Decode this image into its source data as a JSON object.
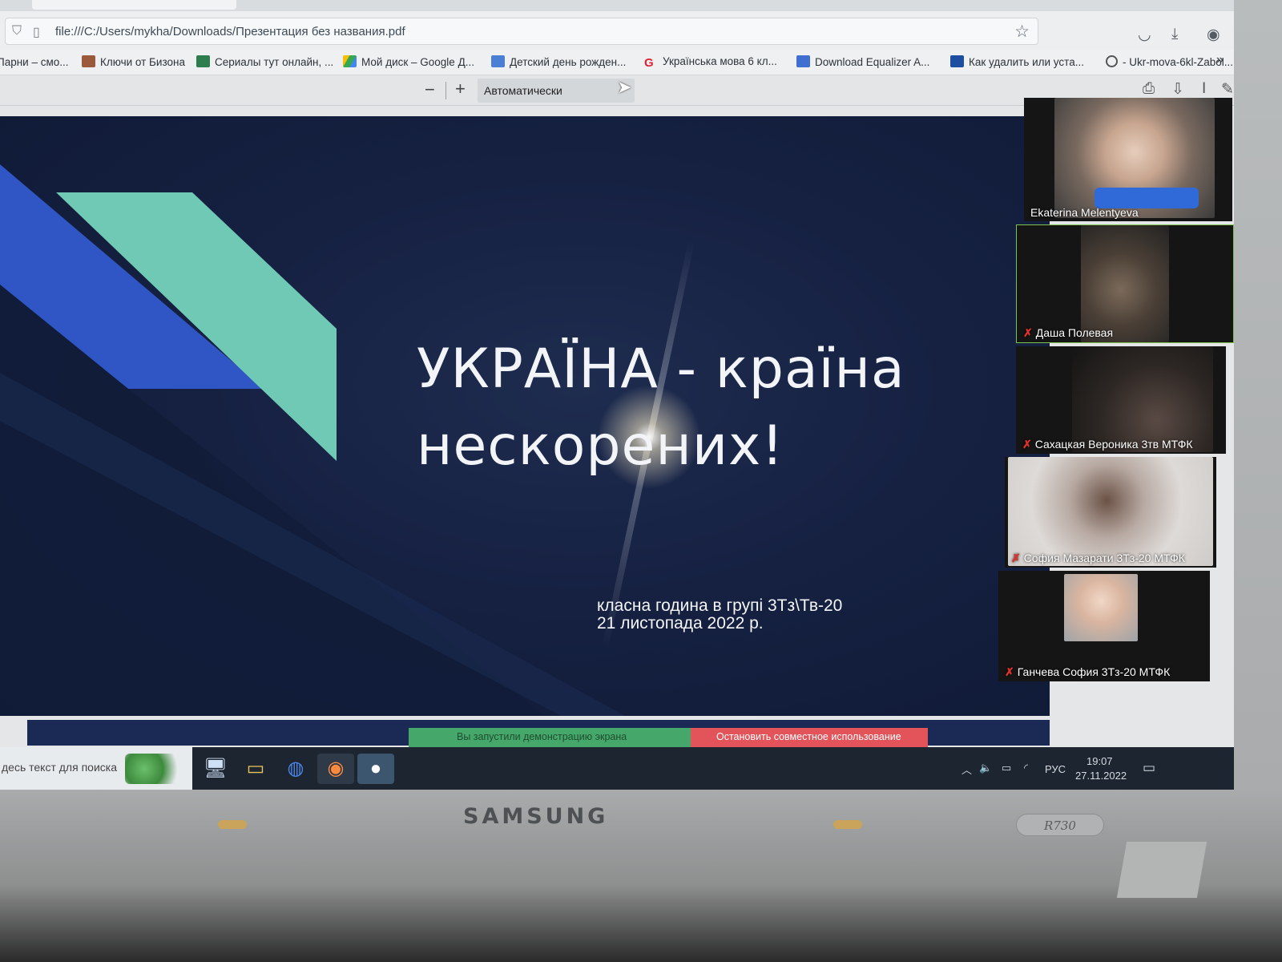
{
  "browser": {
    "url": "file:///C:/Users/mykha/Downloads/Презентация без названия.pdf",
    "bookmarks": [
      "Парни – смо...",
      "Ключи от Бизона",
      "Сериалы тут онлайн, ...",
      "Мой диск – Google Д...",
      "Детский день рожден...",
      "Українська мова 6 кл...",
      "Download Equalizer A...",
      "Как удалить или уста...",
      "- Ukr-mova-6kl-Zabol..."
    ],
    "overflow": "»"
  },
  "pdf_toolbar": {
    "zoom_out": "−",
    "zoom_in": "+",
    "zoom_value": "Автоматически"
  },
  "slide": {
    "title_line1": "УКРАЇНА - країна",
    "title_line2": "нескорених!",
    "subtitle_line1": "класна година в групі 3Тз\\Тв-20",
    "subtitle_line2": "21 листопада 2022 р."
  },
  "participants": [
    {
      "name": "Ekaterina Melentyeva",
      "muted": false
    },
    {
      "name": "Даша Полевая",
      "muted": true
    },
    {
      "name": "Сахацкая Вероника 3тв МТФК",
      "muted": true
    },
    {
      "name": "София Мазарати 3Тз-20 МТФК",
      "muted": true
    },
    {
      "name": "Ганчева София 3Тз-20 МТФК",
      "muted": true
    }
  ],
  "share_bar": {
    "status": "Вы запустили демонстрацию экрана",
    "stop": "Остановить совместное использование"
  },
  "taskbar": {
    "search_placeholder": "десь текст для поиска",
    "language": "РУС",
    "time": "19:07",
    "date": "27.11.2022"
  },
  "laptop": {
    "brand": "SAMSUNG",
    "model": "R730"
  },
  "colors": {
    "slide_bg": "#162142",
    "accent_teal": "#6fc9b4",
    "accent_blue": "#2f56c4",
    "share_green": "#45a86a",
    "share_red": "#e2535a"
  }
}
